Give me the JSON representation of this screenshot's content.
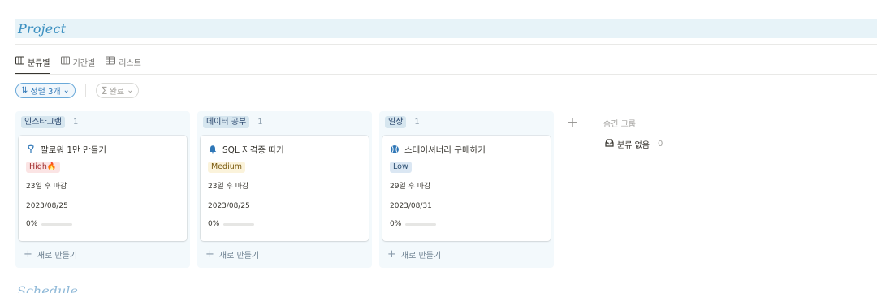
{
  "section": {
    "title": "Project"
  },
  "views": [
    {
      "label": "분류별",
      "icon": "board-icon",
      "active": true
    },
    {
      "label": "기간별",
      "icon": "timeline-icon",
      "active": false
    },
    {
      "label": "리스트",
      "icon": "table-icon",
      "active": false
    }
  ],
  "filters": {
    "sort_label": "정렬 3개",
    "group_label": "완료"
  },
  "columns": [
    {
      "label": "인스타그램",
      "count": "1",
      "card": {
        "title": "팔로워 1만 만들기",
        "icon": "pin-icon",
        "priority": "High🔥",
        "due_text": "23일 후 마감",
        "date": "2023/08/25",
        "progress_text": "0%",
        "progress": 0
      },
      "new_label": "새로 만들기"
    },
    {
      "label": "데이터 공부",
      "count": "1",
      "card": {
        "title": "SQL 자격증 따기",
        "icon": "bell-icon",
        "priority": "Medium",
        "due_text": "23일 후 마감",
        "date": "2023/08/25",
        "progress_text": "0%",
        "progress": 0
      },
      "new_label": "새로 만들기"
    },
    {
      "label": "일상",
      "count": "1",
      "card": {
        "title": "스테이셔너리 구매하기",
        "icon": "baseball-icon",
        "priority": "Low",
        "due_text": "29일 후 마감",
        "date": "2023/08/31",
        "progress_text": "0%",
        "progress": 0
      },
      "new_label": "새로 만들기"
    }
  ],
  "add_group": "+",
  "hidden": {
    "title": "숨긴 그룹",
    "item_label": "분류 없음",
    "item_count": "0"
  },
  "next_section": {
    "title": "Schedule"
  },
  "colors": {
    "accent": "#2f77b7",
    "section_bg": "#e7f3f8",
    "column_bg": "#f3f9fc",
    "high": "#fbe4e4",
    "medium": "#fbf3db",
    "low": "#dbe7f3"
  }
}
